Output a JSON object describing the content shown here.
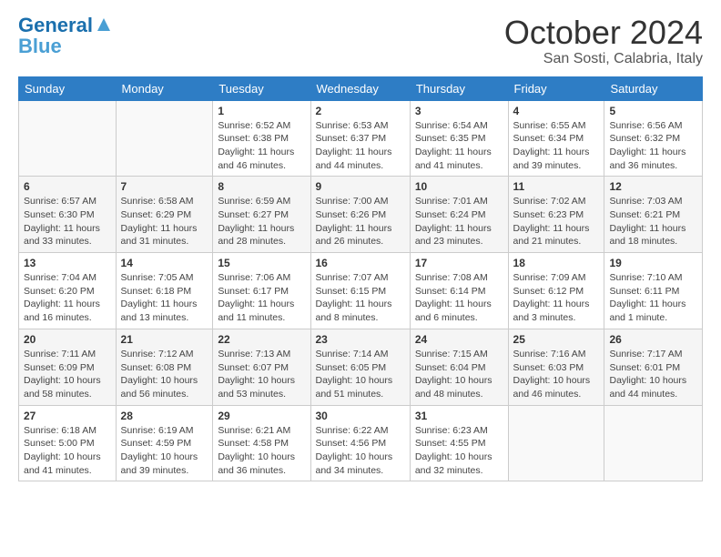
{
  "logo": {
    "line1": "General",
    "line2": "Blue"
  },
  "title": "October 2024",
  "location": "San Sosti, Calabria, Italy",
  "headers": [
    "Sunday",
    "Monday",
    "Tuesday",
    "Wednesday",
    "Thursday",
    "Friday",
    "Saturday"
  ],
  "weeks": [
    [
      {
        "day": "",
        "detail": ""
      },
      {
        "day": "",
        "detail": ""
      },
      {
        "day": "1",
        "detail": "Sunrise: 6:52 AM\nSunset: 6:38 PM\nDaylight: 11 hours and 46 minutes."
      },
      {
        "day": "2",
        "detail": "Sunrise: 6:53 AM\nSunset: 6:37 PM\nDaylight: 11 hours and 44 minutes."
      },
      {
        "day": "3",
        "detail": "Sunrise: 6:54 AM\nSunset: 6:35 PM\nDaylight: 11 hours and 41 minutes."
      },
      {
        "day": "4",
        "detail": "Sunrise: 6:55 AM\nSunset: 6:34 PM\nDaylight: 11 hours and 39 minutes."
      },
      {
        "day": "5",
        "detail": "Sunrise: 6:56 AM\nSunset: 6:32 PM\nDaylight: 11 hours and 36 minutes."
      }
    ],
    [
      {
        "day": "6",
        "detail": "Sunrise: 6:57 AM\nSunset: 6:30 PM\nDaylight: 11 hours and 33 minutes."
      },
      {
        "day": "7",
        "detail": "Sunrise: 6:58 AM\nSunset: 6:29 PM\nDaylight: 11 hours and 31 minutes."
      },
      {
        "day": "8",
        "detail": "Sunrise: 6:59 AM\nSunset: 6:27 PM\nDaylight: 11 hours and 28 minutes."
      },
      {
        "day": "9",
        "detail": "Sunrise: 7:00 AM\nSunset: 6:26 PM\nDaylight: 11 hours and 26 minutes."
      },
      {
        "day": "10",
        "detail": "Sunrise: 7:01 AM\nSunset: 6:24 PM\nDaylight: 11 hours and 23 minutes."
      },
      {
        "day": "11",
        "detail": "Sunrise: 7:02 AM\nSunset: 6:23 PM\nDaylight: 11 hours and 21 minutes."
      },
      {
        "day": "12",
        "detail": "Sunrise: 7:03 AM\nSunset: 6:21 PM\nDaylight: 11 hours and 18 minutes."
      }
    ],
    [
      {
        "day": "13",
        "detail": "Sunrise: 7:04 AM\nSunset: 6:20 PM\nDaylight: 11 hours and 16 minutes."
      },
      {
        "day": "14",
        "detail": "Sunrise: 7:05 AM\nSunset: 6:18 PM\nDaylight: 11 hours and 13 minutes."
      },
      {
        "day": "15",
        "detail": "Sunrise: 7:06 AM\nSunset: 6:17 PM\nDaylight: 11 hours and 11 minutes."
      },
      {
        "day": "16",
        "detail": "Sunrise: 7:07 AM\nSunset: 6:15 PM\nDaylight: 11 hours and 8 minutes."
      },
      {
        "day": "17",
        "detail": "Sunrise: 7:08 AM\nSunset: 6:14 PM\nDaylight: 11 hours and 6 minutes."
      },
      {
        "day": "18",
        "detail": "Sunrise: 7:09 AM\nSunset: 6:12 PM\nDaylight: 11 hours and 3 minutes."
      },
      {
        "day": "19",
        "detail": "Sunrise: 7:10 AM\nSunset: 6:11 PM\nDaylight: 11 hours and 1 minute."
      }
    ],
    [
      {
        "day": "20",
        "detail": "Sunrise: 7:11 AM\nSunset: 6:09 PM\nDaylight: 10 hours and 58 minutes."
      },
      {
        "day": "21",
        "detail": "Sunrise: 7:12 AM\nSunset: 6:08 PM\nDaylight: 10 hours and 56 minutes."
      },
      {
        "day": "22",
        "detail": "Sunrise: 7:13 AM\nSunset: 6:07 PM\nDaylight: 10 hours and 53 minutes."
      },
      {
        "day": "23",
        "detail": "Sunrise: 7:14 AM\nSunset: 6:05 PM\nDaylight: 10 hours and 51 minutes."
      },
      {
        "day": "24",
        "detail": "Sunrise: 7:15 AM\nSunset: 6:04 PM\nDaylight: 10 hours and 48 minutes."
      },
      {
        "day": "25",
        "detail": "Sunrise: 7:16 AM\nSunset: 6:03 PM\nDaylight: 10 hours and 46 minutes."
      },
      {
        "day": "26",
        "detail": "Sunrise: 7:17 AM\nSunset: 6:01 PM\nDaylight: 10 hours and 44 minutes."
      }
    ],
    [
      {
        "day": "27",
        "detail": "Sunrise: 6:18 AM\nSunset: 5:00 PM\nDaylight: 10 hours and 41 minutes."
      },
      {
        "day": "28",
        "detail": "Sunrise: 6:19 AM\nSunset: 4:59 PM\nDaylight: 10 hours and 39 minutes."
      },
      {
        "day": "29",
        "detail": "Sunrise: 6:21 AM\nSunset: 4:58 PM\nDaylight: 10 hours and 36 minutes."
      },
      {
        "day": "30",
        "detail": "Sunrise: 6:22 AM\nSunset: 4:56 PM\nDaylight: 10 hours and 34 minutes."
      },
      {
        "day": "31",
        "detail": "Sunrise: 6:23 AM\nSunset: 4:55 PM\nDaylight: 10 hours and 32 minutes."
      },
      {
        "day": "",
        "detail": ""
      },
      {
        "day": "",
        "detail": ""
      }
    ]
  ]
}
